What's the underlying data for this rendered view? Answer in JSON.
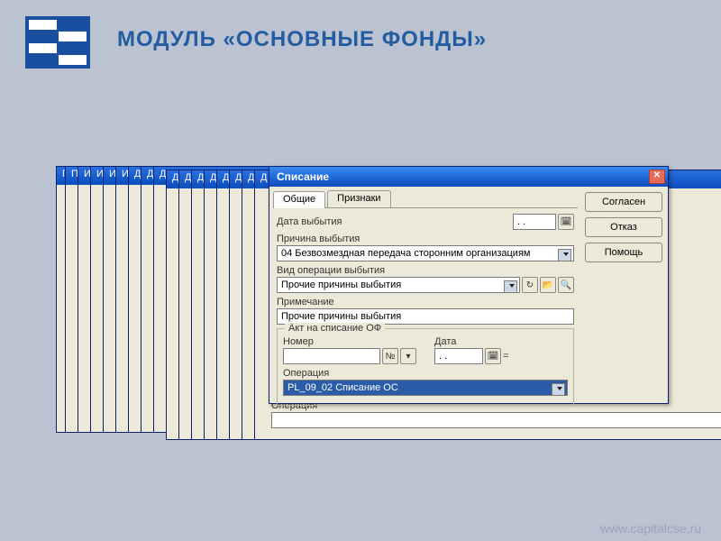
{
  "page_title": "МОДУЛЬ «ОСНОВНЫЕ ФОНДЫ»",
  "footer_url": "www.capitalcse.ru",
  "ghost_titles": [
    "П",
    "По",
    "Из",
    "Из",
    "Из",
    "До",
    "До",
    "До",
    "Д",
    "Д",
    "Д",
    "Д",
    "Д",
    "Д",
    "Д"
  ],
  "window": {
    "title": "Списание",
    "tabs": {
      "tab1": "Общие",
      "tab2": "Признаки"
    },
    "buttons": {
      "agree": "Согласен",
      "cancel": "Отказ",
      "help": "Помощь"
    }
  },
  "form": {
    "disposal_date_label": "Дата выбытия",
    "disposal_date_value": ". .",
    "reason_label": "Причина выбытия",
    "reason_value": "04 Безвозмездная передача сторонним организациям",
    "op_type_label": "Вид операции выбытия",
    "op_type_value": "Прочие причины выбытия",
    "note_label": "Примечание",
    "note_value": "Прочие причины выбытия"
  },
  "act": {
    "legend": "Акт на списание ОФ",
    "number_label": "Номер",
    "number_value": "",
    "number_icon": "№",
    "date_label": "Дата",
    "date_value": ". .",
    "eq": "=",
    "op_label": "Операция",
    "op_value": "PL_09_02 Списание ОС"
  },
  "lower": {
    "op_label": "Операция",
    "op_value": ""
  }
}
